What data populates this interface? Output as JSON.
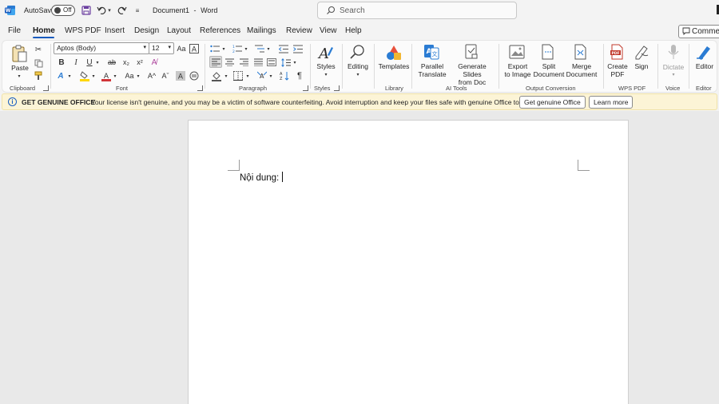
{
  "titlebar": {
    "autosave_label": "AutoSave",
    "autosave_state": "Off",
    "document_title": "Document1",
    "separator": "-",
    "app_name": "Word",
    "search_placeholder": "Search"
  },
  "tabs": [
    {
      "label": "File"
    },
    {
      "label": "Home",
      "active": true
    },
    {
      "label": "WPS PDF"
    },
    {
      "label": "Insert"
    },
    {
      "label": "Design"
    },
    {
      "label": "Layout"
    },
    {
      "label": "References"
    },
    {
      "label": "Mailings"
    },
    {
      "label": "Review"
    },
    {
      "label": "View"
    },
    {
      "label": "Help"
    }
  ],
  "comments_button": "Commen",
  "ribbon": {
    "clipboard": {
      "paste": "Paste",
      "group": "Clipboard"
    },
    "font": {
      "name": "Aptos (Body)",
      "size": "12",
      "group": "Font"
    },
    "paragraph": {
      "group": "Paragraph"
    },
    "styles": {
      "label": "Styles",
      "group": "Styles"
    },
    "editing": {
      "label": "Editing"
    },
    "library": {
      "templates": "Templates",
      "group": "Library"
    },
    "ai_tools": {
      "parallel_translate": [
        "Parallel",
        "Translate"
      ],
      "generate_slides": [
        "Generate Slides",
        "from Doc"
      ],
      "group": "AI Tools"
    },
    "output_conversion": {
      "export_image": [
        "Export",
        "to Image"
      ],
      "split_document": [
        "Split",
        "Document"
      ],
      "merge_document": [
        "Merge",
        "Document"
      ],
      "group": "Output Conversion"
    },
    "wps_pdf": {
      "create_pdf": [
        "Create",
        "PDF"
      ],
      "sign": "Sign",
      "group": "WPS PDF"
    },
    "voice": {
      "dictate": "Dictate",
      "group": "Voice"
    },
    "editor": {
      "label": "Editor",
      "group": "Editor"
    }
  },
  "infobar": {
    "title": "GET GENUINE OFFICE",
    "message": "Your license isn't genuine, and you may be a victim of software counterfeiting. Avoid interruption and keep your files safe with genuine Office today.",
    "get_genuine_button": "Get genuine Office",
    "learn_more_button": "Learn more"
  },
  "document": {
    "text": "Nội dung:"
  },
  "colors": {
    "accent": "#185abd",
    "infobar_bg": "#fcf4d6",
    "highlight_yellow": "#ffd700",
    "font_color_red": "#d13438"
  }
}
